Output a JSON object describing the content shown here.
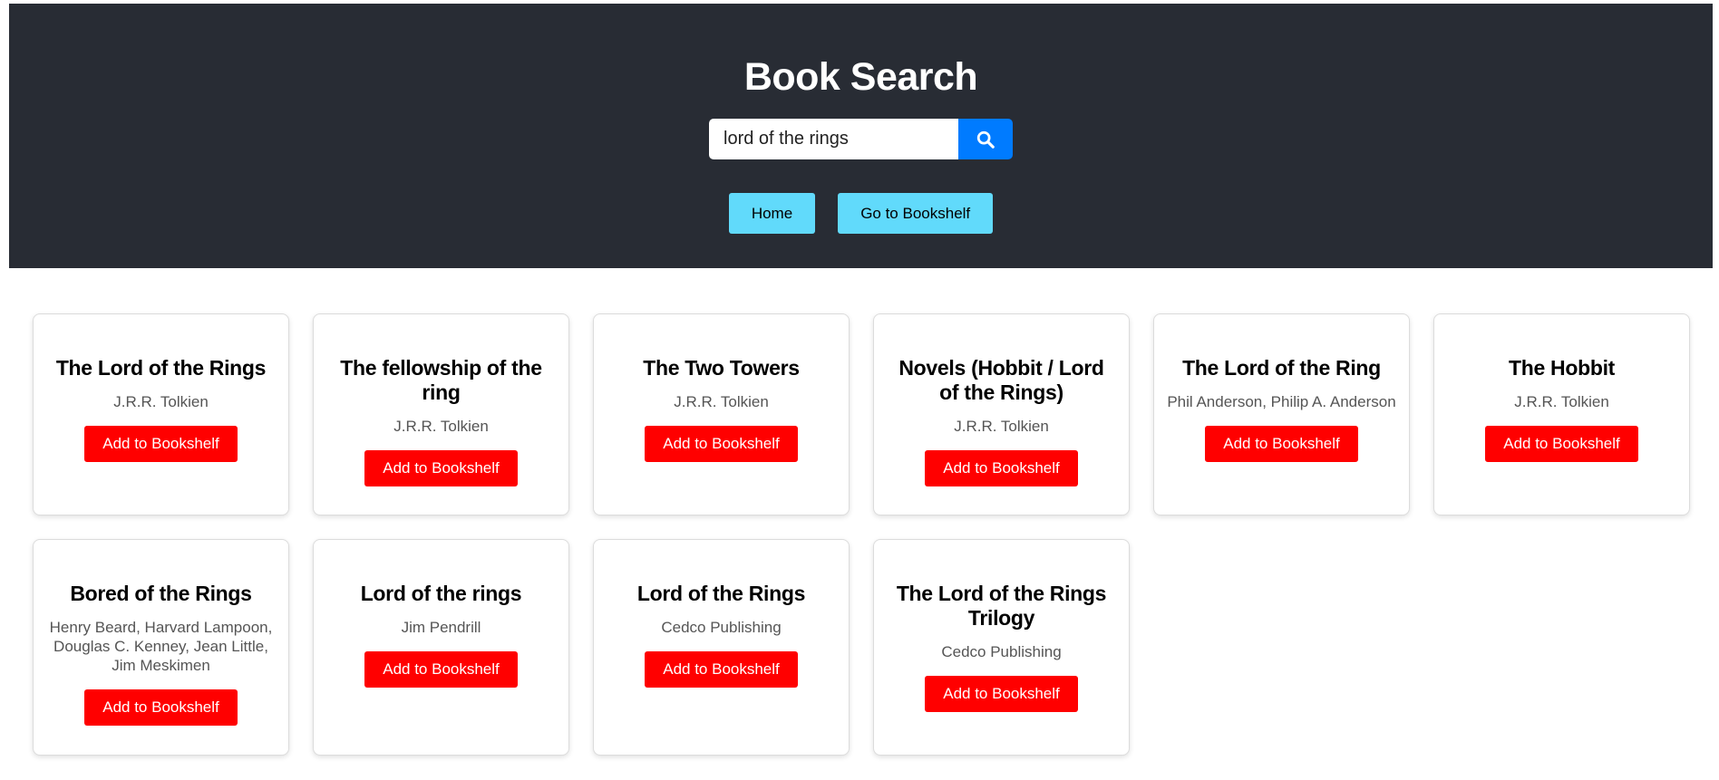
{
  "header": {
    "title": "Book Search",
    "search": {
      "value": "lord of the rings",
      "placeholder": ""
    },
    "search_icon": "search-icon",
    "nav": {
      "home_label": "Home",
      "bookshelf_label": "Go to Bookshelf"
    }
  },
  "colors": {
    "header_bg": "#282c34",
    "search_button": "#007bff",
    "nav_button": "#61dafb",
    "add_button": "#ff0000"
  },
  "results": [
    {
      "title": "The Lord of the Rings",
      "author": "J.R.R. Tolkien",
      "button": "Add to Bookshelf"
    },
    {
      "title": "The fellowship of the ring",
      "author": "J.R.R. Tolkien",
      "button": "Add to Bookshelf"
    },
    {
      "title": "The Two Towers",
      "author": "J.R.R. Tolkien",
      "button": "Add to Bookshelf"
    },
    {
      "title": "Novels (Hobbit / Lord of the Rings)",
      "author": "J.R.R. Tolkien",
      "button": "Add to Bookshelf"
    },
    {
      "title": "The Lord of the Ring",
      "author": "Phil Anderson, Philip A. Anderson",
      "button": "Add to Bookshelf"
    },
    {
      "title": "The Hobbit",
      "author": "J.R.R. Tolkien",
      "button": "Add to Bookshelf"
    },
    {
      "title": "Bored of the Rings",
      "author": "Henry Beard, Harvard Lampoon, Douglas C. Kenney, Jean Little, Jim Meskimen",
      "button": "Add to Bookshelf"
    },
    {
      "title": "Lord of the rings",
      "author": "Jim Pendrill",
      "button": "Add to Bookshelf"
    },
    {
      "title": "Lord of the Rings",
      "author": "Cedco Publishing",
      "button": "Add to Bookshelf"
    },
    {
      "title": "The Lord of the Rings Trilogy",
      "author": "Cedco Publishing",
      "button": "Add to Bookshelf"
    }
  ]
}
